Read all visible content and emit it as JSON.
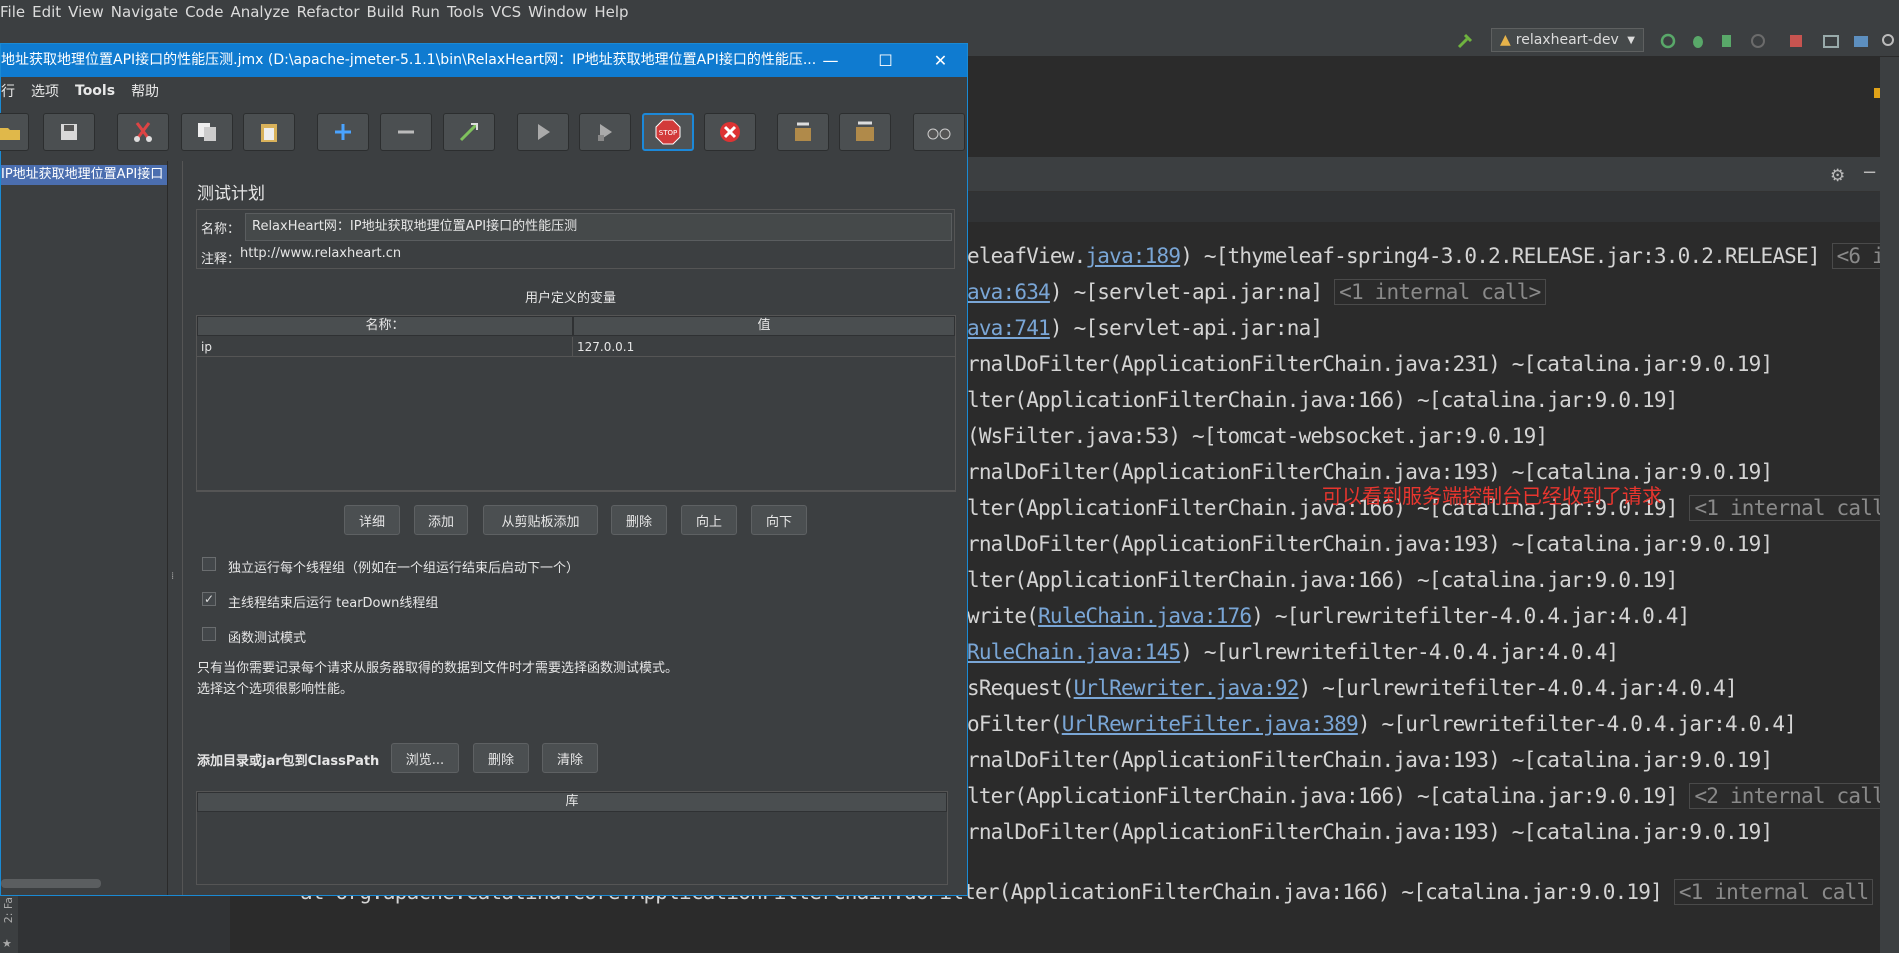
{
  "ide": {
    "menu": [
      "File",
      "Edit",
      "View",
      "Navigate",
      "Code",
      "Analyze",
      "Refactor",
      "Build",
      "Run",
      "Tools",
      "VCS",
      "Window",
      "Help"
    ],
    "run_config": "relaxheart-dev",
    "annotation": "可以看到服务端控制台已经收到了请求",
    "left_strip_label": "2: Fa",
    "console_lines": [
      {
        "pre": "eleafView.",
        "link": "java:189",
        "post": ") ~[thymeleaf-spring4-3.0.2.RELEASE.jar:3.0.2.RELEASE]",
        "tag": "<6 i"
      },
      {
        "pre": "",
        "link": "ava:634",
        "post": ") ~[servlet-api.jar:na]",
        "tag": "<1 internal call>"
      },
      {
        "pre": "",
        "link": "ava:741",
        "post": ") ~[servlet-api.jar:na]",
        "tag": ""
      },
      {
        "pre": "rnalDoFilter(ApplicationFilterChain.java:231) ~[catalina.jar:9.0.19]",
        "link": "",
        "post": "",
        "tag": ""
      },
      {
        "pre": "lter(ApplicationFilterChain.java:166) ~[catalina.jar:9.0.19]",
        "link": "",
        "post": "",
        "tag": ""
      },
      {
        "pre": "(WsFilter.java:53) ~[tomcat-websocket.jar:9.0.19]",
        "link": "",
        "post": "",
        "tag": ""
      },
      {
        "pre": "rnalDoFilter(ApplicationFilterChain.java:193) ~[catalina.jar:9.0.19]",
        "link": "",
        "post": "",
        "tag": ""
      },
      {
        "pre": "lter(ApplicationFilterChain.java:166) ~[catalina.jar:9.0.19]",
        "link": "",
        "post": "",
        "tag": "<1 internal call"
      },
      {
        "pre": "rnalDoFilter(ApplicationFilterChain.java:193) ~[catalina.jar:9.0.19]",
        "link": "",
        "post": "",
        "tag": ""
      },
      {
        "pre": "lter(ApplicationFilterChain.java:166) ~[catalina.jar:9.0.19]",
        "link": "",
        "post": "",
        "tag": ""
      },
      {
        "pre": "write(",
        "link": "RuleChain.java:176",
        "post": ") ~[urlrewritefilter-4.0.4.jar:4.0.4]",
        "tag": ""
      },
      {
        "pre": "",
        "link": "RuleChain.java:145",
        "post": ") ~[urlrewritefilter-4.0.4.jar:4.0.4]",
        "tag": ""
      },
      {
        "pre": "sRequest(",
        "link": "UrlRewriter.java:92",
        "post": ") ~[urlrewritefilter-4.0.4.jar:4.0.4]",
        "tag": ""
      },
      {
        "pre": "oFilter(",
        "link": "UrlRewriteFilter.java:389",
        "post": ") ~[urlrewritefilter-4.0.4.jar:4.0.4]",
        "tag": ""
      },
      {
        "pre": "rnalDoFilter(ApplicationFilterChain.java:193) ~[catalina.jar:9.0.19]",
        "link": "",
        "post": "",
        "tag": ""
      },
      {
        "pre": "lter(ApplicationFilterChain.java:166) ~[catalina.jar:9.0.19]",
        "link": "",
        "post": "",
        "tag": "<2 internal call"
      },
      {
        "pre": "rnalDoFilter(ApplicationFilterChain.java:193) ~[catalina.jar:9.0.19]",
        "link": "",
        "post": "",
        "tag": ""
      }
    ],
    "last_line": "at org.apache.catalina.core.ApplicationFilterChain.doFilter(ApplicationFilterChain.java:166) ~[catalina.jar:9.0.19]",
    "last_line_tag": "<1 internal call"
  },
  "jmeter": {
    "title": "地址获取地理位置API接口的性能压测.jmx (D:\\apache-jmeter-5.1.1\\bin\\RelaxHeart网：IP地址获取地理位置API接口的性能压...",
    "menu": [
      "行",
      "选项",
      "Tools",
      "帮助"
    ],
    "tree_item": "IP地址获取地理位置API接口",
    "panel_title": "测试计划",
    "name_label": "名称：",
    "name_value": "RelaxHeart网：IP地址获取地理位置API接口的性能压测",
    "comment_label": "注释：",
    "comment_value": "http://www.relaxheart.cn",
    "vars_title": "用户定义的变量",
    "vars_columns": [
      "名称：",
      "值"
    ],
    "vars_rows": [
      {
        "name": "ip",
        "value": "127.0.0.1"
      }
    ],
    "vars_buttons": [
      "详细",
      "添加",
      "从剪贴板添加",
      "删除",
      "向上",
      "向下"
    ],
    "options": [
      {
        "label": "独立运行每个线程组（例如在一个组运行结束后启动下一个）",
        "checked": false
      },
      {
        "label": "主线程结束后运行 tearDown线程组",
        "checked": true
      },
      {
        "label": "函数测试模式",
        "checked": false
      }
    ],
    "hint_line1": "只有当你需要记录每个请求从服务器取得的数据到文件时才需要选择函数测试模式。",
    "hint_line2": "选择这个选项很影响性能。",
    "classpath_label": "添加目录或jar包到ClassPath",
    "classpath_buttons": [
      "浏览...",
      "删除",
      "清除"
    ],
    "lib_column": "库"
  }
}
